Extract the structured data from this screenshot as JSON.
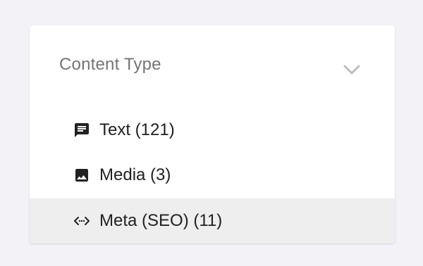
{
  "filter": {
    "title": "Content Type",
    "items": [
      {
        "label": "Text (121)",
        "icon": "message-icon"
      },
      {
        "label": "Media (3)",
        "icon": "image-icon"
      },
      {
        "label": "Meta (SEO) (11)",
        "icon": "code-icon",
        "selected": true
      }
    ]
  },
  "colors": {
    "background": "#f3f3f7",
    "card": "#ffffff",
    "title": "#757575",
    "item_text": "#212121",
    "selected_background": "#eeeeee"
  }
}
